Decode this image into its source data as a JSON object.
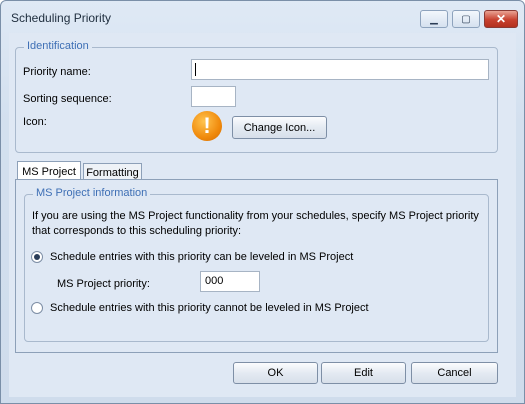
{
  "window": {
    "title": "Scheduling Priority",
    "minimize_glyph": "▁",
    "maximize_glyph": "▢",
    "close_glyph": "✕"
  },
  "identification": {
    "legend": "Identification",
    "priority_name_label": "Priority name:",
    "priority_name_value": "",
    "sorting_sequence_label": "Sorting sequence:",
    "sorting_sequence_value": "",
    "icon_label": "Icon:",
    "icon_name": "warning-icon",
    "icon_glyph": "!",
    "change_icon_button": "Change Icon..."
  },
  "tabs": [
    {
      "label": "MS Project",
      "active": true
    },
    {
      "label": "Formatting",
      "active": false
    }
  ],
  "ms_project": {
    "legend": "MS Project information",
    "description": "If you are using the MS Project functionality from your schedules, specify MS Project priority that corresponds to this scheduling priority:",
    "radio_leveled_label": "Schedule entries with this priority can be leveled in MS Project",
    "radio_leveled_checked": true,
    "priority_label": "MS Project priority:",
    "priority_value": "000",
    "radio_not_leveled_label": "Schedule entries with this priority cannot be leveled in MS Project",
    "radio_not_leveled_checked": false
  },
  "footer": {
    "ok": "OK",
    "edit": "Edit",
    "cancel": "Cancel"
  }
}
